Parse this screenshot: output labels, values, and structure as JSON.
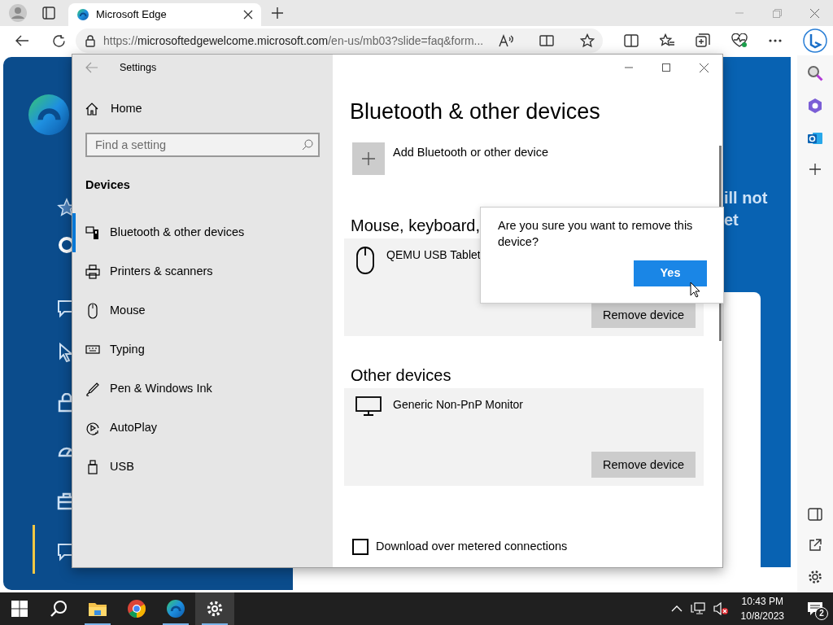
{
  "browser": {
    "tabs": [
      {
        "title": "Microsoft Edge",
        "selected": true
      }
    ],
    "address": {
      "scheme": "https://",
      "domain": "microsoftedgewelcome.microsoft.com",
      "path": "/en-us/mb03?slide=faq&form..."
    }
  },
  "page": {
    "headline_lines": [
      "ill not",
      "et"
    ]
  },
  "settings": {
    "title": "Settings",
    "home": "Home",
    "search": {
      "placeholder": "Find a setting"
    },
    "section": "Devices",
    "nav": [
      {
        "label": "Bluetooth & other devices",
        "kind": "bluetooth",
        "selected": true
      },
      {
        "label": "Printers & scanners",
        "kind": "printer",
        "selected": false
      },
      {
        "label": "Mouse",
        "kind": "mouse",
        "selected": false
      },
      {
        "label": "Typing",
        "kind": "keyboard",
        "selected": false
      },
      {
        "label": "Pen & Windows Ink",
        "kind": "pen",
        "selected": false
      },
      {
        "label": "AutoPlay",
        "kind": "autoplay",
        "selected": false
      },
      {
        "label": "USB",
        "kind": "usb",
        "selected": false
      }
    ],
    "heading": "Bluetooth & other devices",
    "add_label": "Add Bluetooth or other device",
    "groups": [
      {
        "title": "Mouse, keyboard,",
        "devices": [
          {
            "name": "QEMU USB Tablet",
            "kind": "mouse",
            "button": "Remove device"
          }
        ]
      },
      {
        "title": "Other devices",
        "devices": [
          {
            "name": "Generic Non-PnP Monitor",
            "kind": "monitor",
            "button": "Remove device"
          }
        ]
      }
    ],
    "checkbox": {
      "label": "Download over metered connections",
      "checked": false
    }
  },
  "dialog": {
    "message": "Are you sure you want to remove this device?",
    "button": "Yes"
  },
  "taskbar": {
    "apps": [
      {
        "kind": "search",
        "selected": false,
        "running": false
      },
      {
        "kind": "folder",
        "selected": false,
        "running": true
      },
      {
        "kind": "chrome",
        "selected": false,
        "running": false
      },
      {
        "kind": "edge",
        "selected": false,
        "running": true
      },
      {
        "kind": "settings",
        "selected": true,
        "running": true
      }
    ],
    "time": "10:43 PM",
    "date": "10/8/2023",
    "notification_count": "2"
  }
}
